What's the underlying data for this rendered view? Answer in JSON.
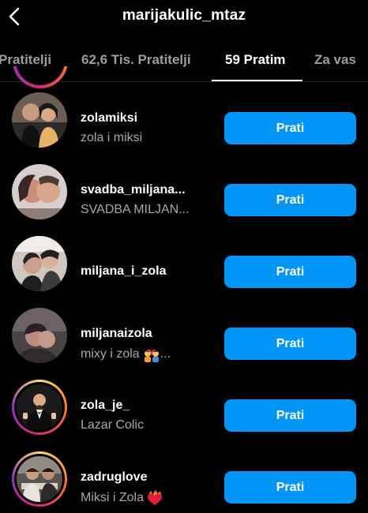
{
  "header": {
    "title": "marijakulic_mtaz"
  },
  "tabs": [
    {
      "label": "Pratitelji"
    },
    {
      "label": "62,6 Tis. Pratitelji"
    },
    {
      "label": "59 Pratim"
    },
    {
      "label": "Za vas"
    }
  ],
  "active_tab": "59 Pratim",
  "accounts": [
    {
      "username": "zolamiksi",
      "full_name": "zola i miksi",
      "button": "Prati"
    },
    {
      "username": "svadba_miljana...",
      "full_name": "SVADBA MILJAN...",
      "button": "Prati"
    },
    {
      "username": "miljana_i_zola",
      "full_name": "",
      "button": "Prati"
    },
    {
      "username": "miljanaizola",
      "full_name": "mixy i zola",
      "full_name_suffix": "...",
      "emoji_icon": "kissing-couple-emoji",
      "button": "Prati"
    },
    {
      "username": "zola_je_",
      "full_name": "Lazar Colic",
      "button": "Prati",
      "story_ring": true
    },
    {
      "username": "zadruglove",
      "full_name": "Miksi i Zola",
      "emoji_icon": "heart-on-fire-emoji",
      "button": "Prati",
      "story_ring": true
    }
  ],
  "colors": {
    "accent": "#0095f6",
    "background": "#000000",
    "secondary_text": "#a8a8a8"
  }
}
